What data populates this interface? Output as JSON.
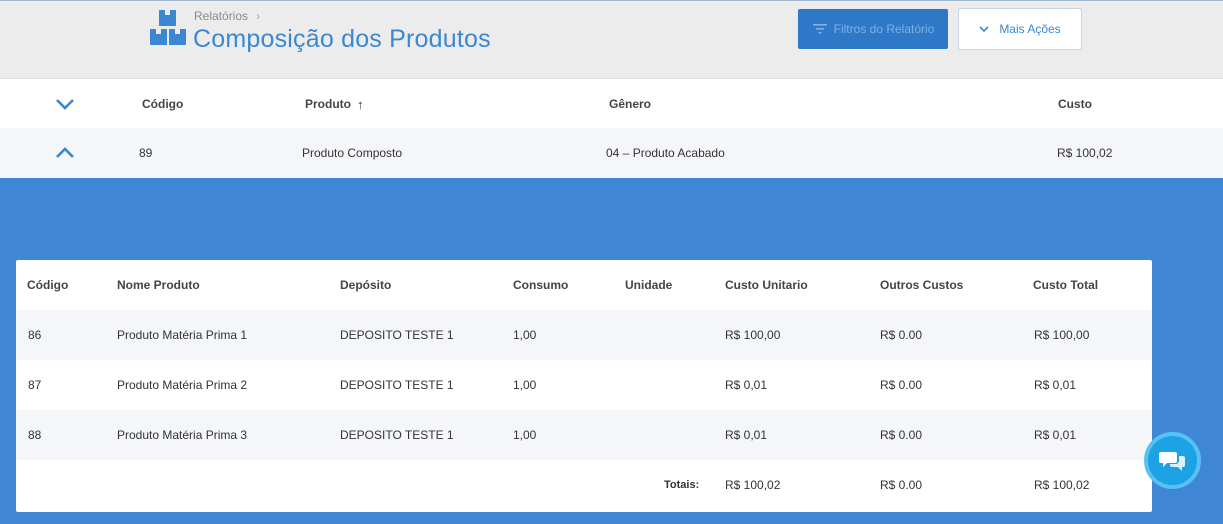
{
  "header": {
    "breadcrumb": "Relatórios",
    "title": "Composição dos Produtos",
    "filter_button": "Filtros do Relatório",
    "more_button": "Mais Ações"
  },
  "grid": {
    "columns": [
      "Código",
      "Produto",
      "Gênero",
      "Custo"
    ],
    "sort": {
      "column": "Produto",
      "direction": "ascending"
    },
    "row": {
      "codigo": "89",
      "produto": "Produto Composto",
      "genero": "04 – Produto Acabado",
      "custo": "R$ 100,02"
    }
  },
  "detail": {
    "columns": [
      "Código",
      "Nome Produto",
      "Depósito",
      "Consumo",
      "Unidade",
      "Custo Unitario",
      "Outros Custos",
      "Custo Total"
    ],
    "rows": [
      {
        "codigo": "86",
        "nome": "Produto Matéria Prima 1",
        "deposito": "DEPOSITO TESTE 1",
        "consumo": "1,00",
        "unidade": "",
        "custo_unitario": "R$ 100,00",
        "outros_custos": "R$ 0.00",
        "custo_total": "R$ 100,00"
      },
      {
        "codigo": "87",
        "nome": "Produto Matéria Prima 2",
        "deposito": "DEPOSITO TESTE 1",
        "consumo": "1,00",
        "unidade": "",
        "custo_unitario": "R$ 0,01",
        "outros_custos": "R$ 0.00",
        "custo_total": "R$ 0,01"
      },
      {
        "codigo": "88",
        "nome": "Produto Matéria Prima 3",
        "deposito": "DEPOSITO TESTE 1",
        "consumo": "1,00",
        "unidade": "",
        "custo_unitario": "R$ 0,01",
        "outros_custos": "R$ 0.00",
        "custo_total": "R$ 0,01"
      }
    ],
    "totals": {
      "label": "Totais:",
      "custo_unitario": "R$ 100,02",
      "outros_custos": "R$ 0.00",
      "custo_total": "R$ 100,02"
    }
  },
  "icons": {
    "logo": "boxes-icon",
    "breadcrumb_separator": "chevron-right-icon",
    "filter": "filter-icon",
    "more": "chevron-down-icon",
    "collapse_all": "chevron-down-icon",
    "row_toggle": "chevron-up-icon",
    "sort": "arrow-up-icon",
    "chat": "chat-icon"
  },
  "colors": {
    "accent": "#3b87d2",
    "primary_button": "#2e78c8",
    "expand_background": "#3f87d4",
    "chat": "#1ea2e6"
  }
}
